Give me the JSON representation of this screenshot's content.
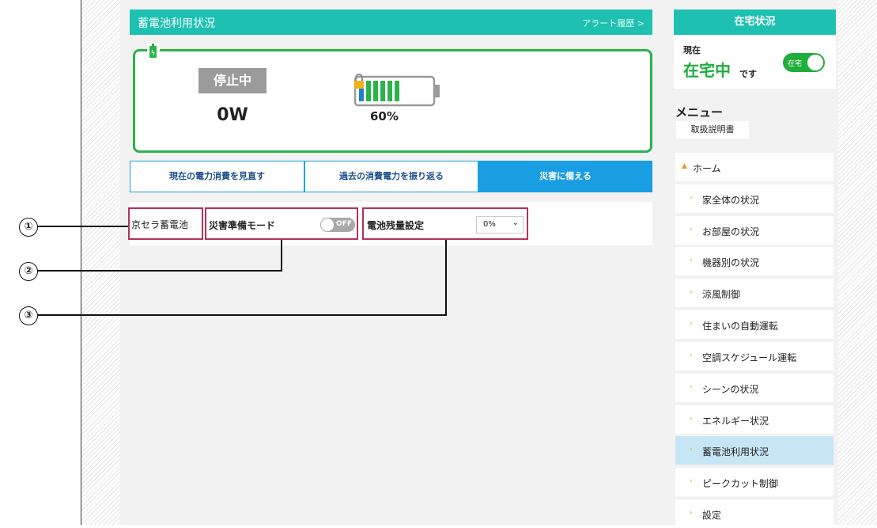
{
  "panel": {
    "title": "蓄電池利用状況",
    "alert_link": "アラート履歴 >"
  },
  "status": {
    "state_badge": "停止中",
    "watts": "0W",
    "battery_percent": "60%",
    "battery_level": 0.6
  },
  "tabs": [
    {
      "label": "現在の電力消費を見直す",
      "active": false
    },
    {
      "label": "過去の消費電力を振り返る",
      "active": false
    },
    {
      "label": "災害に備える",
      "active": true
    }
  ],
  "settings": {
    "device": "京セラ蓄電池",
    "disaster_mode_label": "災害準備モード",
    "disaster_mode_toggle": "OFF",
    "remaining_label": "電池残量設定",
    "remaining_value": "0%"
  },
  "callouts": [
    "①",
    "②",
    "③"
  ],
  "presence": {
    "header": "在宅状況",
    "now": "現在",
    "status": "在宅中",
    "suffix": "です",
    "toggle_label": "在宅"
  },
  "menu": {
    "title": "メニュー",
    "manual": "取扱説明書",
    "items": [
      {
        "label": "ホーム",
        "active": false
      },
      {
        "label": "家全体の状況",
        "active": false
      },
      {
        "label": "お部屋の状況",
        "active": false
      },
      {
        "label": "機器別の状況",
        "active": false
      },
      {
        "label": "涼風制御",
        "active": false
      },
      {
        "label": "住まいの自動運転",
        "active": false
      },
      {
        "label": "空調スケジュール運転",
        "active": false
      },
      {
        "label": "シーンの状況",
        "active": false
      },
      {
        "label": "エネルギー状況",
        "active": false
      },
      {
        "label": "蓄電池利用状況",
        "active": true
      },
      {
        "label": "ピークカット制御",
        "active": false
      },
      {
        "label": "設定",
        "active": false
      }
    ]
  },
  "colors": {
    "teal": "#1ec1b1",
    "green": "#2bb34a",
    "blue": "#1a9ee3",
    "highlight": "#b5315a",
    "active_menu": "#c7e6f5"
  }
}
